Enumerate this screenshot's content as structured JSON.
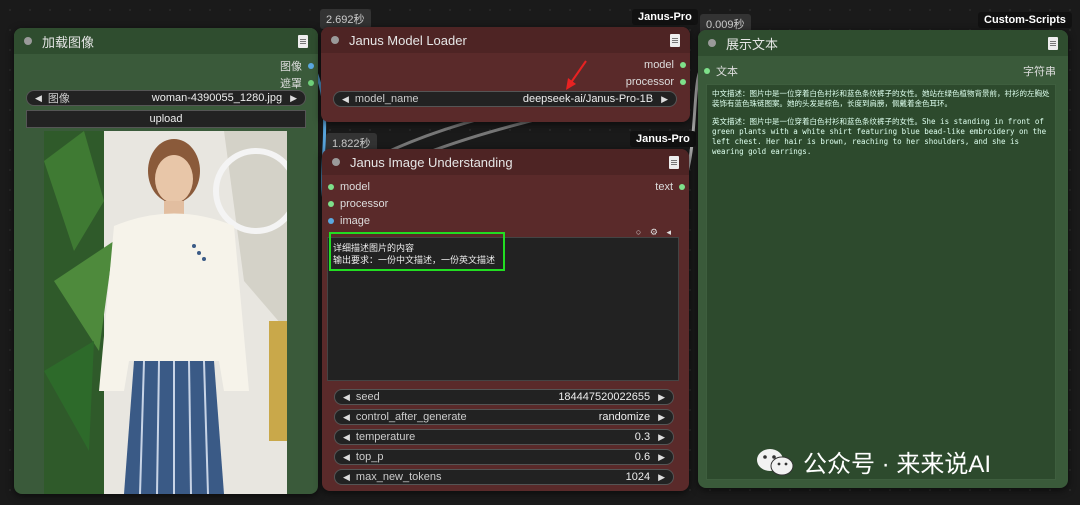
{
  "load_image_node": {
    "title": "加载图像",
    "outputs": [
      "图像",
      "遮罩"
    ],
    "file_widget": {
      "label": "图像",
      "value": "woman-4390055_1280.jpg"
    },
    "upload_label": "upload"
  },
  "model_loader_node": {
    "timer": "2.692秒",
    "tag": "Janus-Pro",
    "title": "Janus Model Loader",
    "outputs": [
      "model",
      "processor"
    ],
    "model_widget": {
      "label": "model_name",
      "value": "deepseek-ai/Janus-Pro-1B"
    }
  },
  "understanding_node": {
    "timer": "1.822秒",
    "tag": "Janus-Pro",
    "title": "Janus Image Understanding",
    "inputs": [
      "model",
      "processor",
      "image"
    ],
    "output": "text",
    "prompt_line1": "详细描述图片的内容",
    "prompt_line2": "输出要求：一份中文描述，一份英文描述",
    "widgets": [
      {
        "label": "seed",
        "value": "184447520022655"
      },
      {
        "label": "control_after_generate",
        "value": "randomize"
      },
      {
        "label": "temperature",
        "value": "0.3"
      },
      {
        "label": "top_p",
        "value": "0.6"
      },
      {
        "label": "max_new_tokens",
        "value": "1024"
      }
    ]
  },
  "show_text_node": {
    "timer": "0.009秒",
    "tag": "Custom-Scripts",
    "title": "展示文本",
    "input_label": "文本",
    "output_label": "字符串",
    "text_cn": "中文描述：图片中是一位穿着白色衬衫和蓝色条纹裤子的女性。她站在绿色植物背景前，衬衫的左胸处装饰有蓝色珠链图案。她的头发是棕色，长度到肩膀，佩戴着金色耳环。",
    "text_en": "英文描述：图片中是一位穿着白色衬衫和蓝色条纹裤子的女性。She is standing in front of green plants with a white shirt featuring blue bead-like embroidery on the left chest. Her hair is brown, reaching to her shoulders, and she is wearing gold earrings."
  },
  "watermark": "公众号 · 来来说AI",
  "colors": {
    "green_node": "#3a5a3a",
    "red_node": "#5a2a2a",
    "highlight": "#22dd22",
    "arrow": "#e82222"
  }
}
